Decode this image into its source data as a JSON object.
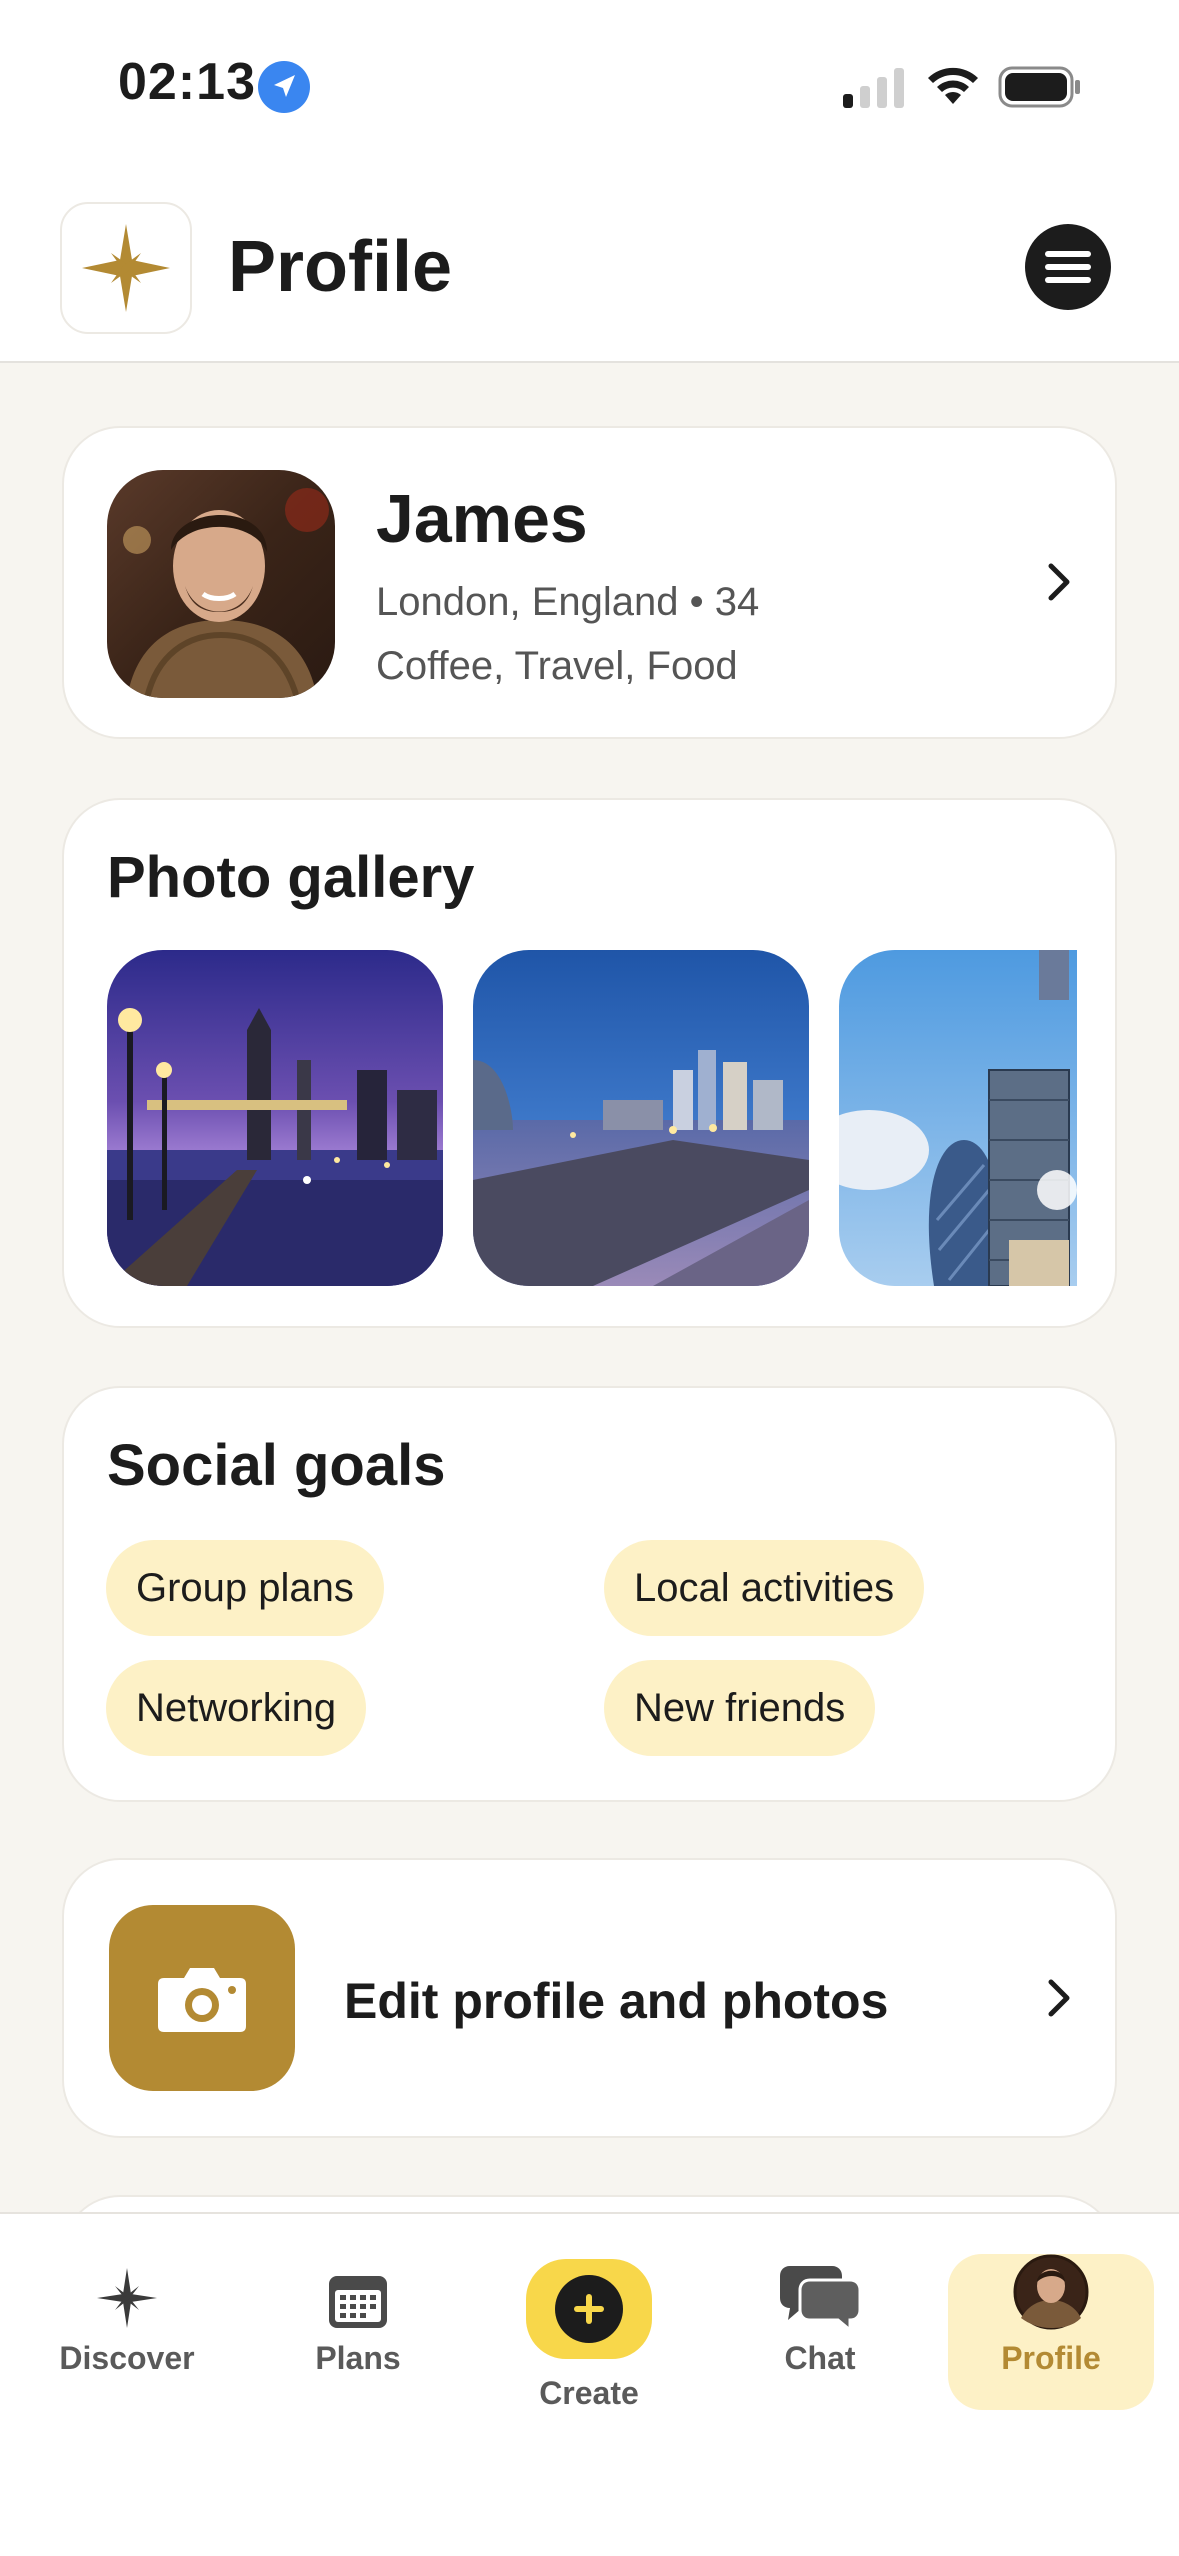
{
  "status_bar": {
    "time": "02:13",
    "icons": [
      "location-arrow-icon",
      "cellular-signal-icon",
      "wifi-icon",
      "battery-icon"
    ]
  },
  "header": {
    "title": "Profile",
    "logo_icon": "sparkle-star-icon",
    "menu_icon": "hamburger-menu-icon"
  },
  "profile": {
    "name": "James",
    "meta": "London, England • 34",
    "interests": "Coffee, Travel, Food"
  },
  "gallery": {
    "title": "Photo gallery",
    "photos": [
      "tower-bridge-night",
      "thames-riverside-dusk",
      "gherkin-city-skyline"
    ]
  },
  "social_goals": {
    "title": "Social goals",
    "chips": [
      "Group plans",
      "Local activities",
      "Networking",
      "New friends"
    ]
  },
  "edit": {
    "label": "Edit profile and photos",
    "icon": "camera-icon"
  },
  "nav": {
    "items": [
      {
        "label": "Discover",
        "icon": "sparkle-star-icon"
      },
      {
        "label": "Plans",
        "icon": "calendar-icon"
      },
      {
        "label": "Create",
        "icon": "plus-circle-icon"
      },
      {
        "label": "Chat",
        "icon": "chat-bubbles-icon"
      },
      {
        "label": "Profile",
        "icon": "avatar-icon"
      }
    ],
    "active": "Profile"
  },
  "colors": {
    "background": "#f7f5f0",
    "accent_gold": "#b38a33",
    "chip_yellow": "#fdf1c6",
    "create_yellow": "#f8d74a",
    "active_label": "#b38a33"
  }
}
